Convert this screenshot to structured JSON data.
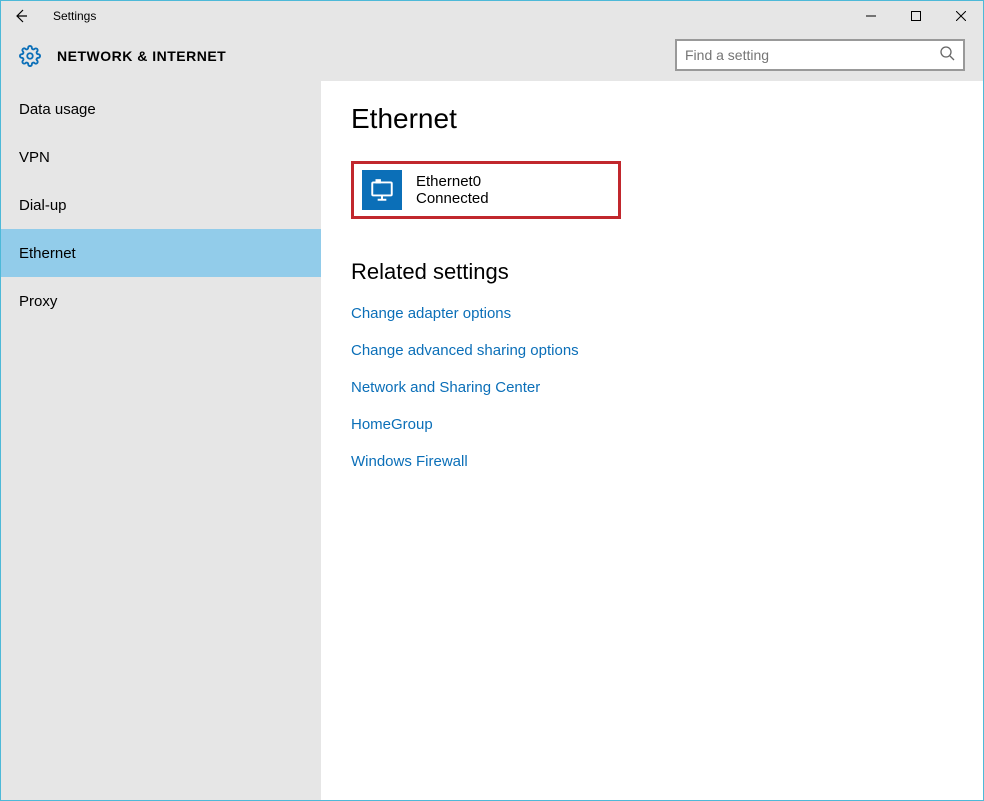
{
  "window": {
    "title": "Settings"
  },
  "header": {
    "category": "NETWORK & INTERNET"
  },
  "search": {
    "placeholder": "Find a setting"
  },
  "sidebar": {
    "items": [
      {
        "label": "Data usage",
        "selected": false
      },
      {
        "label": "VPN",
        "selected": false
      },
      {
        "label": "Dial-up",
        "selected": false
      },
      {
        "label": "Ethernet",
        "selected": true
      },
      {
        "label": "Proxy",
        "selected": false
      }
    ]
  },
  "main": {
    "title": "Ethernet",
    "adapter": {
      "name": "Ethernet0",
      "status": "Connected"
    },
    "related_title": "Related settings",
    "related_links": [
      "Change adapter options",
      "Change advanced sharing options",
      "Network and Sharing Center",
      "HomeGroup",
      "Windows Firewall"
    ]
  }
}
